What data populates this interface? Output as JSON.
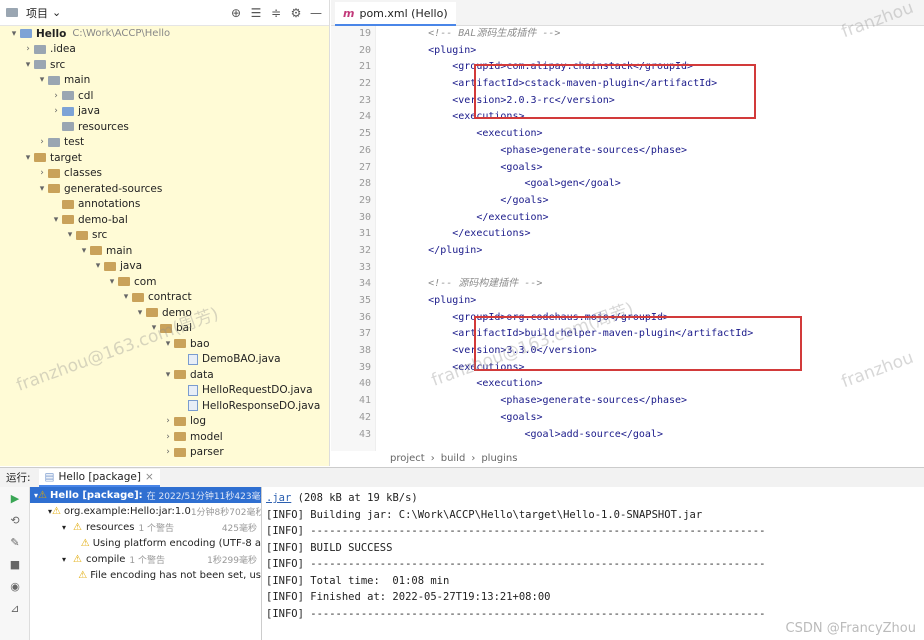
{
  "project": {
    "title": "项目",
    "tree": [
      {
        "depth": 0,
        "arrow": "▾",
        "icon": "blue",
        "label": "Hello",
        "muted": "C:\\Work\\ACCP\\Hello",
        "bold": true
      },
      {
        "depth": 1,
        "arrow": "›",
        "icon": "gray",
        "label": ".idea"
      },
      {
        "depth": 1,
        "arrow": "▾",
        "icon": "gray",
        "label": "src"
      },
      {
        "depth": 2,
        "arrow": "▾",
        "icon": "gray",
        "label": "main"
      },
      {
        "depth": 3,
        "arrow": "›",
        "icon": "gray",
        "label": "cdl"
      },
      {
        "depth": 3,
        "arrow": "›",
        "icon": "blue",
        "label": "java"
      },
      {
        "depth": 3,
        "arrow": "",
        "icon": "gray",
        "label": "resources"
      },
      {
        "depth": 2,
        "arrow": "›",
        "icon": "gray",
        "label": "test"
      },
      {
        "depth": 1,
        "arrow": "▾",
        "icon": "orange",
        "label": "target"
      },
      {
        "depth": 2,
        "arrow": "›",
        "icon": "orange",
        "label": "classes"
      },
      {
        "depth": 2,
        "arrow": "▾",
        "icon": "orange",
        "label": "generated-sources"
      },
      {
        "depth": 3,
        "arrow": "",
        "icon": "orange",
        "label": "annotations"
      },
      {
        "depth": 3,
        "arrow": "▾",
        "icon": "orange",
        "label": "demo-bal"
      },
      {
        "depth": 4,
        "arrow": "▾",
        "icon": "orange",
        "label": "src"
      },
      {
        "depth": 5,
        "arrow": "▾",
        "icon": "orange",
        "label": "main"
      },
      {
        "depth": 6,
        "arrow": "▾",
        "icon": "orange",
        "label": "java"
      },
      {
        "depth": 7,
        "arrow": "▾",
        "icon": "orange",
        "label": "com"
      },
      {
        "depth": 8,
        "arrow": "▾",
        "icon": "orange",
        "label": "contract"
      },
      {
        "depth": 9,
        "arrow": "▾",
        "icon": "orange",
        "label": "demo"
      },
      {
        "depth": 10,
        "arrow": "▾",
        "icon": "orange",
        "label": "bal"
      },
      {
        "depth": 11,
        "arrow": "▾",
        "icon": "orange",
        "label": "bao"
      },
      {
        "depth": 12,
        "arrow": "",
        "icon": "file",
        "label": "DemoBAO.java"
      },
      {
        "depth": 11,
        "arrow": "▾",
        "icon": "orange",
        "label": "data"
      },
      {
        "depth": 12,
        "arrow": "",
        "icon": "file",
        "label": "HelloRequestDO.java"
      },
      {
        "depth": 12,
        "arrow": "",
        "icon": "file",
        "label": "HelloResponseDO.java"
      },
      {
        "depth": 11,
        "arrow": "›",
        "icon": "orange",
        "label": "log"
      },
      {
        "depth": 11,
        "arrow": "›",
        "icon": "orange",
        "label": "model"
      },
      {
        "depth": 11,
        "arrow": "›",
        "icon": "orange",
        "label": "parser"
      }
    ]
  },
  "editor": {
    "tab_icon": "m",
    "tab_label": "pom.xml (Hello)",
    "lines": [
      {
        "n": "19",
        "t": "        <!-- BAL源码生成插件 -->",
        "c": true
      },
      {
        "n": "20",
        "t": "        <plugin>"
      },
      {
        "n": "21",
        "t": "            <groupId>com.alipay.chainstack</groupId>"
      },
      {
        "n": "22",
        "t": "            <artifactId>cstack-maven-plugin</artifactId>"
      },
      {
        "n": "23",
        "t": "            <version>2.0.3-rc</version>"
      },
      {
        "n": "24",
        "t": "            <executions>"
      },
      {
        "n": "25",
        "t": "                <execution>"
      },
      {
        "n": "26",
        "t": "                    <phase>generate-sources</phase>"
      },
      {
        "n": "27",
        "t": "                    <goals>"
      },
      {
        "n": "28",
        "t": "                        <goal>gen</goal>"
      },
      {
        "n": "29",
        "t": "                    </goals>"
      },
      {
        "n": "30",
        "t": "                </execution>"
      },
      {
        "n": "31",
        "t": "            </executions>"
      },
      {
        "n": "32",
        "t": "        </plugin>"
      },
      {
        "n": "33",
        "t": ""
      },
      {
        "n": "34",
        "t": "        <!-- 源码构建插件 -->",
        "c": true
      },
      {
        "n": "35",
        "t": "        <plugin>"
      },
      {
        "n": "36",
        "t": "            <groupId>org.codehaus.mojo</groupId>"
      },
      {
        "n": "37",
        "t": "            <artifactId>build-helper-maven-plugin</artifactId>"
      },
      {
        "n": "38",
        "t": "            <version>3.3.0</version>"
      },
      {
        "n": "39",
        "t": "            <executions>"
      },
      {
        "n": "40",
        "t": "                <execution>"
      },
      {
        "n": "41",
        "t": "                    <phase>generate-sources</phase>"
      },
      {
        "n": "42",
        "t": "                    <goals>"
      },
      {
        "n": "43",
        "t": "                        <goal>add-source</goal>"
      }
    ],
    "breadcrumb": [
      "project",
      "build",
      "plugins"
    ]
  },
  "run": {
    "header_label": "运行:",
    "tab_label": "Hello [package]",
    "tree": [
      {
        "depth": 0,
        "label": "Hello [package]:",
        "muted": "在 2022/5",
        "time": "1分钟11秒423毫秒",
        "sel": true
      },
      {
        "depth": 1,
        "label": "org.example:Hello:jar:1.0",
        "muted": "",
        "time": "1分钟8秒702毫秒"
      },
      {
        "depth": 2,
        "label": "resources",
        "muted": "1 个警告",
        "time": "425毫秒"
      },
      {
        "depth": 3,
        "label": "Using platform encoding (UTF-8 a",
        "muted": "",
        "time": ""
      },
      {
        "depth": 2,
        "label": "compile",
        "muted": "1 个警告",
        "time": "1秒299毫秒"
      },
      {
        "depth": 3,
        "label": "File encoding has not been set, us",
        "muted": "",
        "time": ""
      }
    ],
    "console": [
      {
        "link": ".jar",
        "rest": " (208 kB at 19 kB/s)"
      },
      {
        "link": "",
        "rest": "[INFO] Building jar: C:\\Work\\ACCP\\Hello\\target\\Hello-1.0-SNAPSHOT.jar"
      },
      {
        "link": "",
        "rest": "[INFO] ------------------------------------------------------------------------"
      },
      {
        "link": "",
        "rest": "[INFO] BUILD SUCCESS"
      },
      {
        "link": "",
        "rest": "[INFO] ------------------------------------------------------------------------"
      },
      {
        "link": "",
        "rest": "[INFO] Total time:  01:08 min"
      },
      {
        "link": "",
        "rest": "[INFO] Finished at: 2022-05-27T19:13:21+08:00"
      },
      {
        "link": "",
        "rest": "[INFO] ------------------------------------------------------------------------"
      }
    ]
  },
  "watermarks": [
    "franzhou@163.com(周芳)",
    "franzhou@163.com(周芳)",
    "franzhou",
    "franzhou"
  ],
  "csdn": "CSDN @FrancyZhou"
}
